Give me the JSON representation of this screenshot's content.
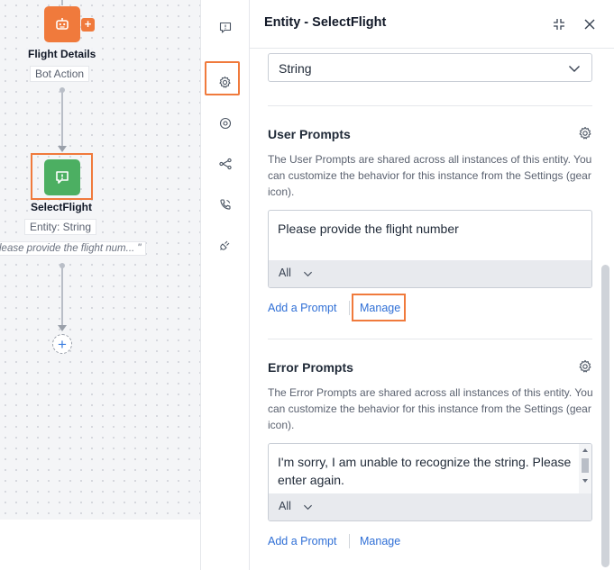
{
  "flow": {
    "node1": {
      "title": "Flight Details",
      "subtitle": "Bot Action",
      "icon": "bot-icon"
    },
    "node2": {
      "title": "SelectFlight",
      "subtitle": "Entity: String",
      "prompt": "lease provide the flight num... \"",
      "icon": "chat-question-icon"
    },
    "add_label": "+"
  },
  "toolbar": {
    "items": [
      "chat-question-icon",
      "gear-icon",
      "target-icon",
      "share-nodes-icon",
      "phone-icon",
      "plug-icon"
    ],
    "active": "gear-icon"
  },
  "panel": {
    "title": "Entity - SelectFlight",
    "type_select": {
      "value": "String"
    },
    "user_prompts": {
      "title": "User Prompts",
      "description": "The User Prompts are shared across all instances of this entity. You can customize the behavior for this instance from the Settings (gear icon).",
      "prompt_text": "Please provide the flight number",
      "channel": "All",
      "add_link": "Add a Prompt",
      "manage_link": "Manage"
    },
    "error_prompts": {
      "title": "Error Prompts",
      "description": "The Error Prompts are shared across all instances of this entity. You can customize the behavior for this instance from the Settings (gear icon).",
      "prompt_text": "I'm sorry, I am unable to recognize the string. Please enter again.",
      "channel": "All",
      "add_link": "Add a Prompt",
      "manage_link": "Manage"
    }
  },
  "colors": {
    "accent_orange": "#f07a3c",
    "node_green": "#4caf62",
    "link_blue": "#2f6fd6"
  }
}
